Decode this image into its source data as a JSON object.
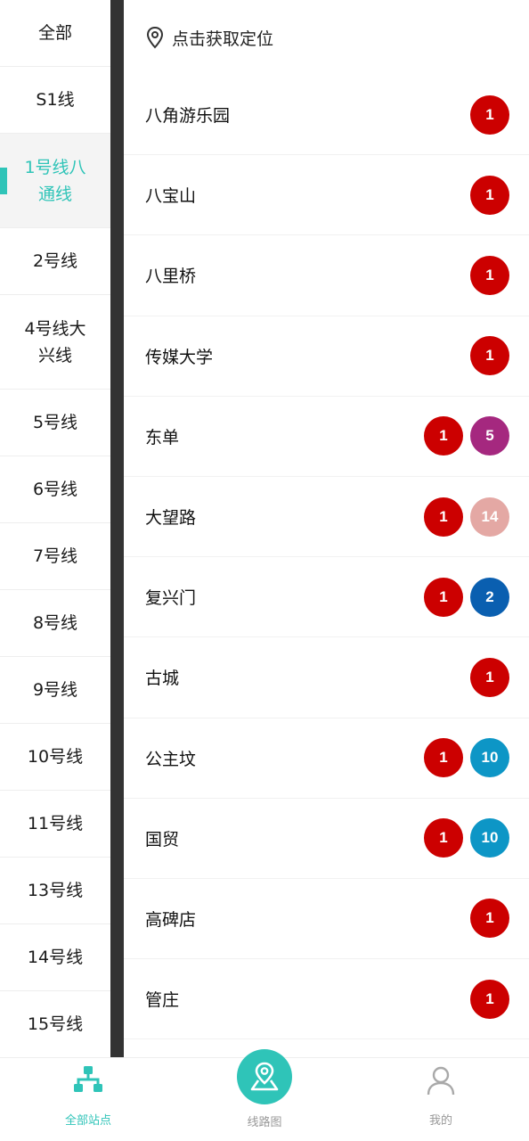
{
  "sidebar": {
    "items": [
      {
        "label": "全部",
        "active": false,
        "height": 75
      },
      {
        "label": "S1线",
        "active": false,
        "height": 75
      },
      {
        "label": "1号线八通线",
        "active": true,
        "height": 106
      },
      {
        "label": "2号线",
        "active": false,
        "height": 75
      },
      {
        "label": "4号线大兴线",
        "active": false,
        "height": 106
      },
      {
        "label": "5号线",
        "active": false,
        "height": 75
      },
      {
        "label": "6号线",
        "active": false,
        "height": 75
      },
      {
        "label": "7号线",
        "active": false,
        "height": 75
      },
      {
        "label": "8号线",
        "active": false,
        "height": 75
      },
      {
        "label": "9号线",
        "active": false,
        "height": 75
      },
      {
        "label": "10号线",
        "active": false,
        "height": 75
      },
      {
        "label": "11号线",
        "active": false,
        "height": 75
      },
      {
        "label": "13号线",
        "active": false,
        "height": 75
      },
      {
        "label": "14号线",
        "active": false,
        "height": 75
      },
      {
        "label": "15号线",
        "active": false,
        "height": 75
      }
    ]
  },
  "content": {
    "locate_label": "点击获取定位",
    "stations": [
      {
        "name": "八角游乐园",
        "lines": [
          {
            "n": "1",
            "color": "#cc0000"
          }
        ]
      },
      {
        "name": "八宝山",
        "lines": [
          {
            "n": "1",
            "color": "#cc0000"
          }
        ]
      },
      {
        "name": "八里桥",
        "lines": [
          {
            "n": "1",
            "color": "#cc0000"
          }
        ]
      },
      {
        "name": "传媒大学",
        "lines": [
          {
            "n": "1",
            "color": "#cc0000"
          }
        ]
      },
      {
        "name": "东单",
        "lines": [
          {
            "n": "1",
            "color": "#cc0000"
          },
          {
            "n": "5",
            "color": "#a5287f"
          }
        ]
      },
      {
        "name": "大望路",
        "lines": [
          {
            "n": "1",
            "color": "#cc0000"
          },
          {
            "n": "14",
            "color": "#e4a8a4"
          }
        ]
      },
      {
        "name": "复兴门",
        "lines": [
          {
            "n": "1",
            "color": "#cc0000"
          },
          {
            "n": "2",
            "color": "#0a5fb0"
          }
        ]
      },
      {
        "name": "古城",
        "lines": [
          {
            "n": "1",
            "color": "#cc0000"
          }
        ]
      },
      {
        "name": "公主坟",
        "lines": [
          {
            "n": "1",
            "color": "#cc0000"
          },
          {
            "n": "10",
            "color": "#0d96c6"
          }
        ]
      },
      {
        "name": "国贸",
        "lines": [
          {
            "n": "1",
            "color": "#cc0000"
          },
          {
            "n": "10",
            "color": "#0d96c6"
          }
        ]
      },
      {
        "name": "高碑店",
        "lines": [
          {
            "n": "1",
            "color": "#cc0000"
          }
        ]
      },
      {
        "name": "管庄",
        "lines": [
          {
            "n": "1",
            "color": "#cc0000"
          }
        ]
      }
    ]
  },
  "bottom_nav": {
    "all_stations": "全部站点",
    "route_map": "线路图",
    "mine": "我的",
    "accent": "#2fc4b8",
    "inactive": "#999999"
  }
}
